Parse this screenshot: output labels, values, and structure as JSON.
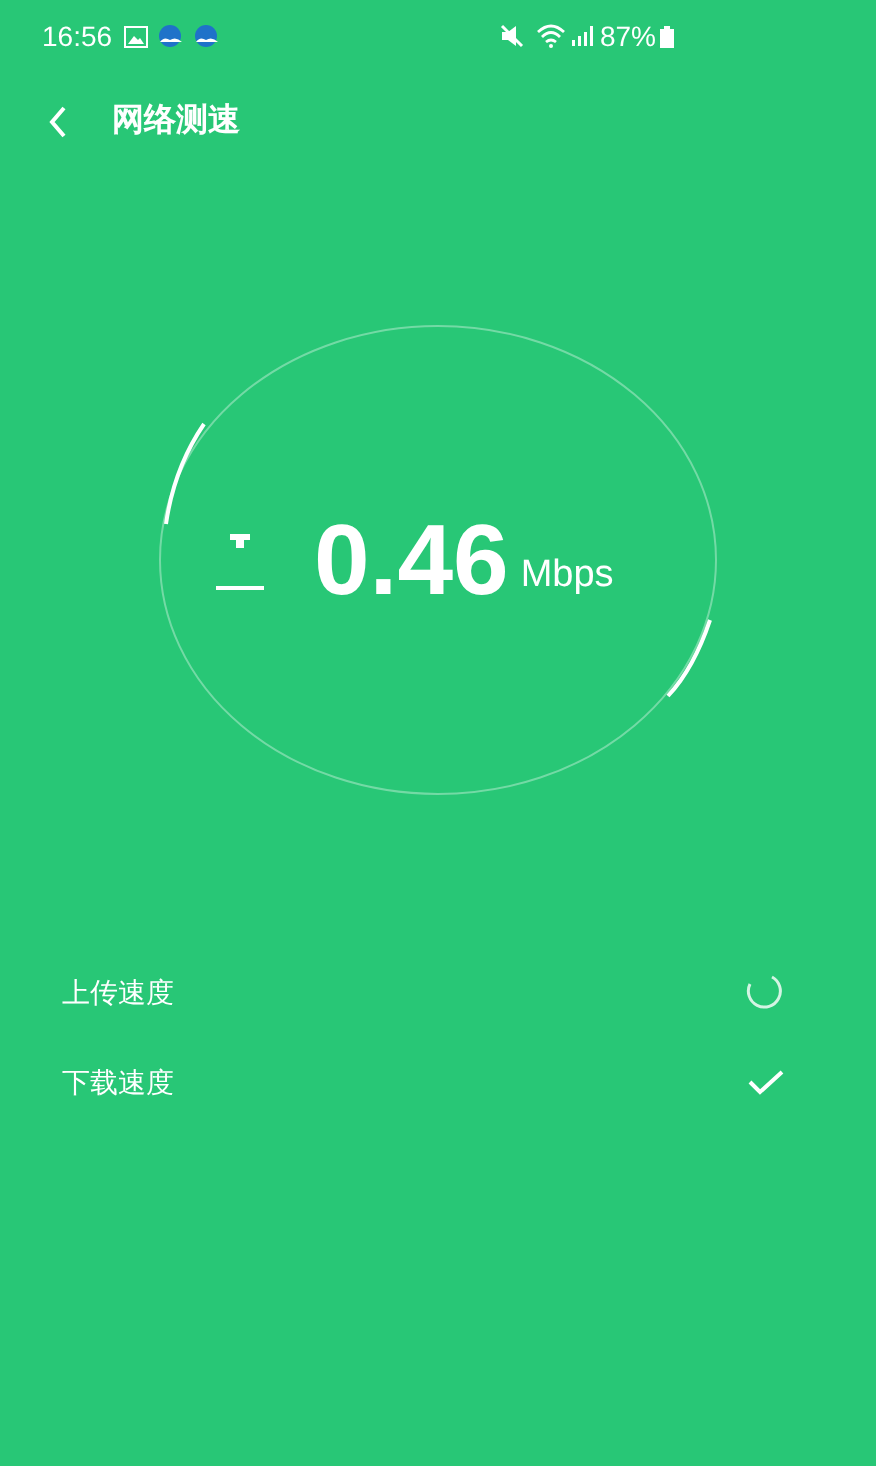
{
  "status_bar": {
    "time": "16:56",
    "battery": "87%"
  },
  "header": {
    "title": "网络测速"
  },
  "meter": {
    "value": "0.46",
    "unit": "Mbps"
  },
  "tests": [
    {
      "label": "上传速度",
      "kind": "running"
    },
    {
      "label": "下载速度",
      "kind": "done"
    }
  ]
}
